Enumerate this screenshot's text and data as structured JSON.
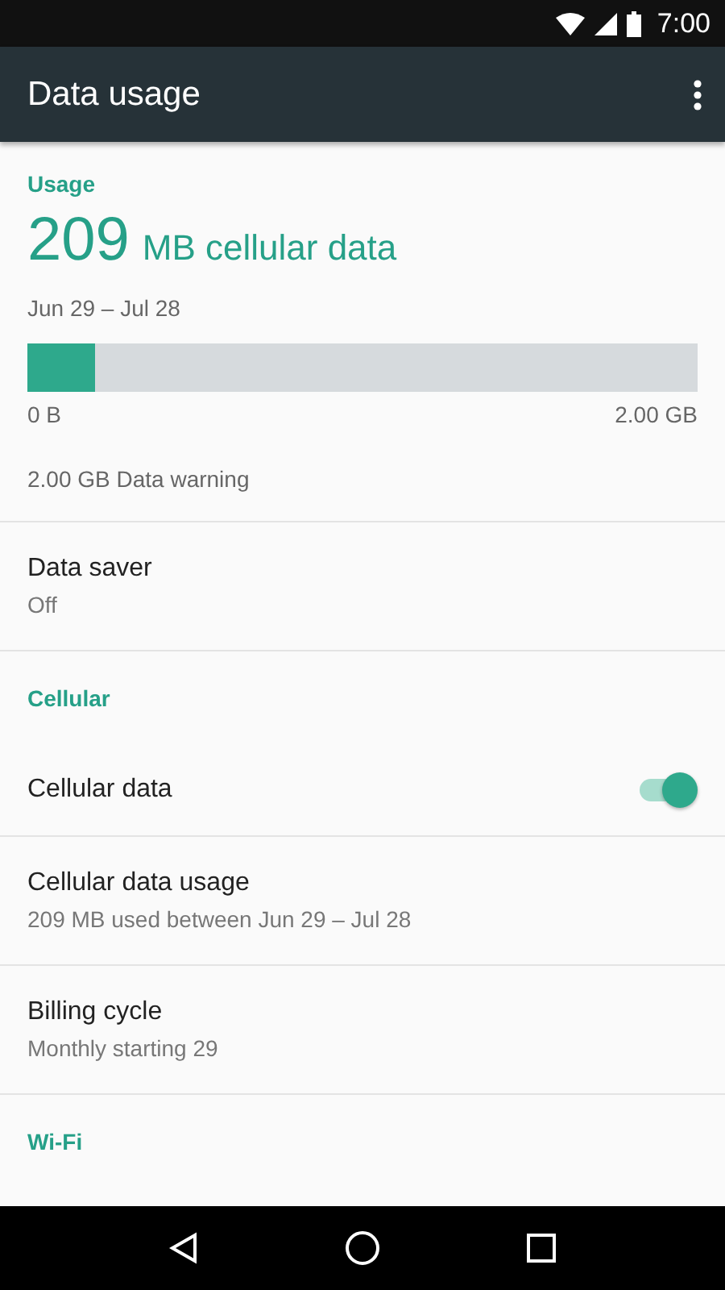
{
  "status_bar": {
    "time": "7:00"
  },
  "toolbar": {
    "title": "Data usage"
  },
  "usage": {
    "header": "Usage",
    "amount": "209",
    "unit": "MB cellular data",
    "period": "Jun 29 – Jul 28",
    "level": 0.1,
    "min_label": "0 B",
    "max_label": "2.00 GB",
    "warning": "2.00 GB Data warning"
  },
  "items": [
    {
      "kind": "two-line",
      "title": "Data saver",
      "summary": "Off"
    },
    {
      "kind": "header",
      "title": "Cellular"
    },
    {
      "kind": "switch",
      "title": "Cellular data",
      "on": true
    },
    {
      "kind": "two-line",
      "title": "Cellular data usage",
      "summary": "209 MB used between Jun 29 – Jul 28"
    },
    {
      "kind": "two-line",
      "title": "Billing cycle",
      "summary": "Monthly starting 29"
    },
    {
      "kind": "header",
      "title": "Wi-Fi"
    }
  ]
}
